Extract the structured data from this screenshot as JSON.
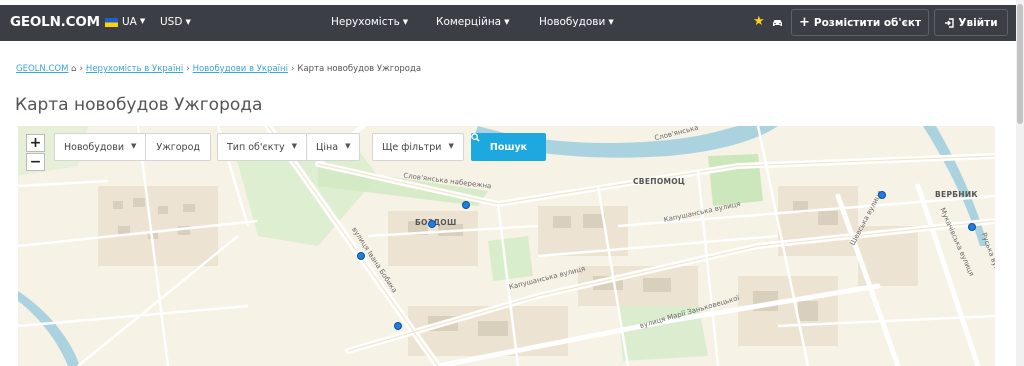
{
  "header": {
    "logo": "GEOLN.COM",
    "language": "UA",
    "currency": "USD",
    "nav": [
      {
        "label": "Нерухомість"
      },
      {
        "label": "Комерційна"
      },
      {
        "label": "Новобудови"
      }
    ],
    "post_button": "Розмістити об'єкт",
    "login_button": "Увійти"
  },
  "breadcrumb": [
    {
      "label": "GEOLN.COM"
    },
    {
      "label": "Нерухомість в Україні"
    },
    {
      "label": "Новобудови в Україні"
    },
    {
      "label": "Карта новобудов Ужгорода"
    }
  ],
  "page_title": "Карта новобудов Ужгорода",
  "filters": {
    "type_select": "Новобудови",
    "city_input": "Ужгород",
    "object_type": "Тип об'єкту",
    "price": "Ціна",
    "more": "Ще фільтри",
    "search_button": "Пошук"
  },
  "map": {
    "zoom_in": "+",
    "zoom_out": "−",
    "districts": [
      "БОЗДОШ",
      "СВЕПОМОЦ",
      "ВЕРБНИК"
    ],
    "streets": [
      "Слов'янська набережна",
      "Капушанська вулиця",
      "Капушанська вулиця",
      "вулиця Івана Бобика",
      "вулиця Марії Заньковецької",
      "Шевська вулиця",
      "Мукачівська вулиця",
      "Руська вулиця",
      "Слов'янська"
    ]
  },
  "colors": {
    "header_bg": "#3b3f45",
    "accent": "#1ea8e0",
    "link": "#3aa6d8",
    "pin": "#1e7fe0",
    "star": "#ffd21a"
  }
}
